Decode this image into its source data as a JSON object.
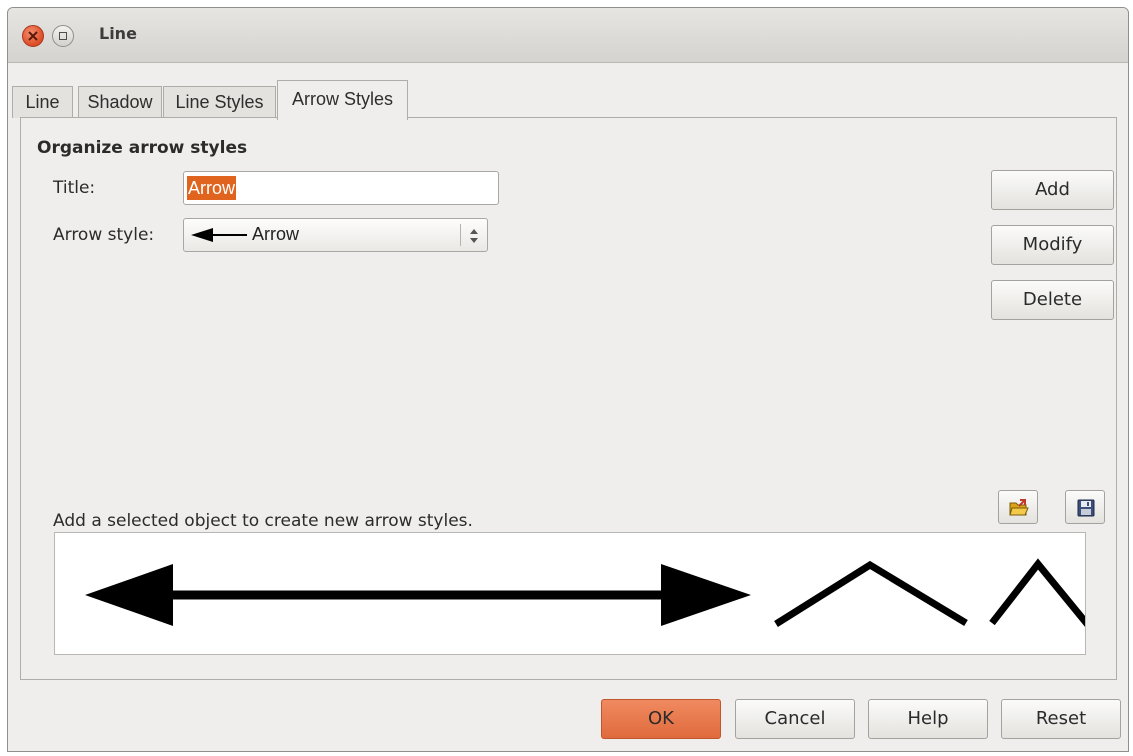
{
  "window": {
    "title": "Line"
  },
  "tabs": [
    {
      "label": "Line",
      "active": false
    },
    {
      "label": "Shadow",
      "active": false
    },
    {
      "label": "Line Styles",
      "active": false
    },
    {
      "label": "Arrow Styles",
      "active": true
    }
  ],
  "organize": {
    "heading": "Organize arrow styles",
    "title_label": "Title:",
    "title_value": "Arrow",
    "arrow_style_label": "Arrow style:",
    "arrow_style_value": "Arrow",
    "buttons": {
      "add": "Add",
      "modify": "Modify",
      "delete": "Delete"
    },
    "hint": "Add a selected object to create new arrow styles.",
    "load_icon": "open-folder-icon",
    "save_icon": "floppy-save-icon"
  },
  "footer": {
    "ok": "OK",
    "cancel": "Cancel",
    "help": "Help",
    "reset": "Reset"
  },
  "colors": {
    "accent": "#e0641e",
    "ok_button": "#e8774a",
    "close_button": "#e0502a"
  }
}
